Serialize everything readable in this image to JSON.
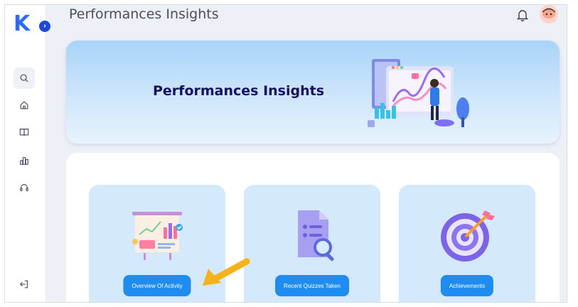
{
  "header": {
    "title": "Performances Insights"
  },
  "logo": {
    "letter": "K",
    "badge": "›"
  },
  "sidebar": {
    "items": [
      {
        "icon": "search-icon",
        "active": true
      },
      {
        "icon": "home-icon",
        "active": false
      },
      {
        "icon": "book-icon",
        "active": false
      },
      {
        "icon": "bar-chart-icon",
        "active": false
      },
      {
        "icon": "headset-icon",
        "active": false
      }
    ],
    "bottom_icon": "logout-icon"
  },
  "banner": {
    "title": "Performances Insights"
  },
  "cards": [
    {
      "button_label": "Overview Of Activity",
      "icon": "presentation-chart-icon"
    },
    {
      "button_label": "Recent Quizzes Taken",
      "icon": "document-search-icon"
    },
    {
      "button_label": "Achievements",
      "icon": "target-arrow-icon"
    }
  ],
  "colors": {
    "accent": "#1e8cf1",
    "banner_title": "#15115e",
    "logo": "#2f6bf2",
    "card_bg": "#d4e9fb",
    "arrow": "#f6b21a"
  }
}
